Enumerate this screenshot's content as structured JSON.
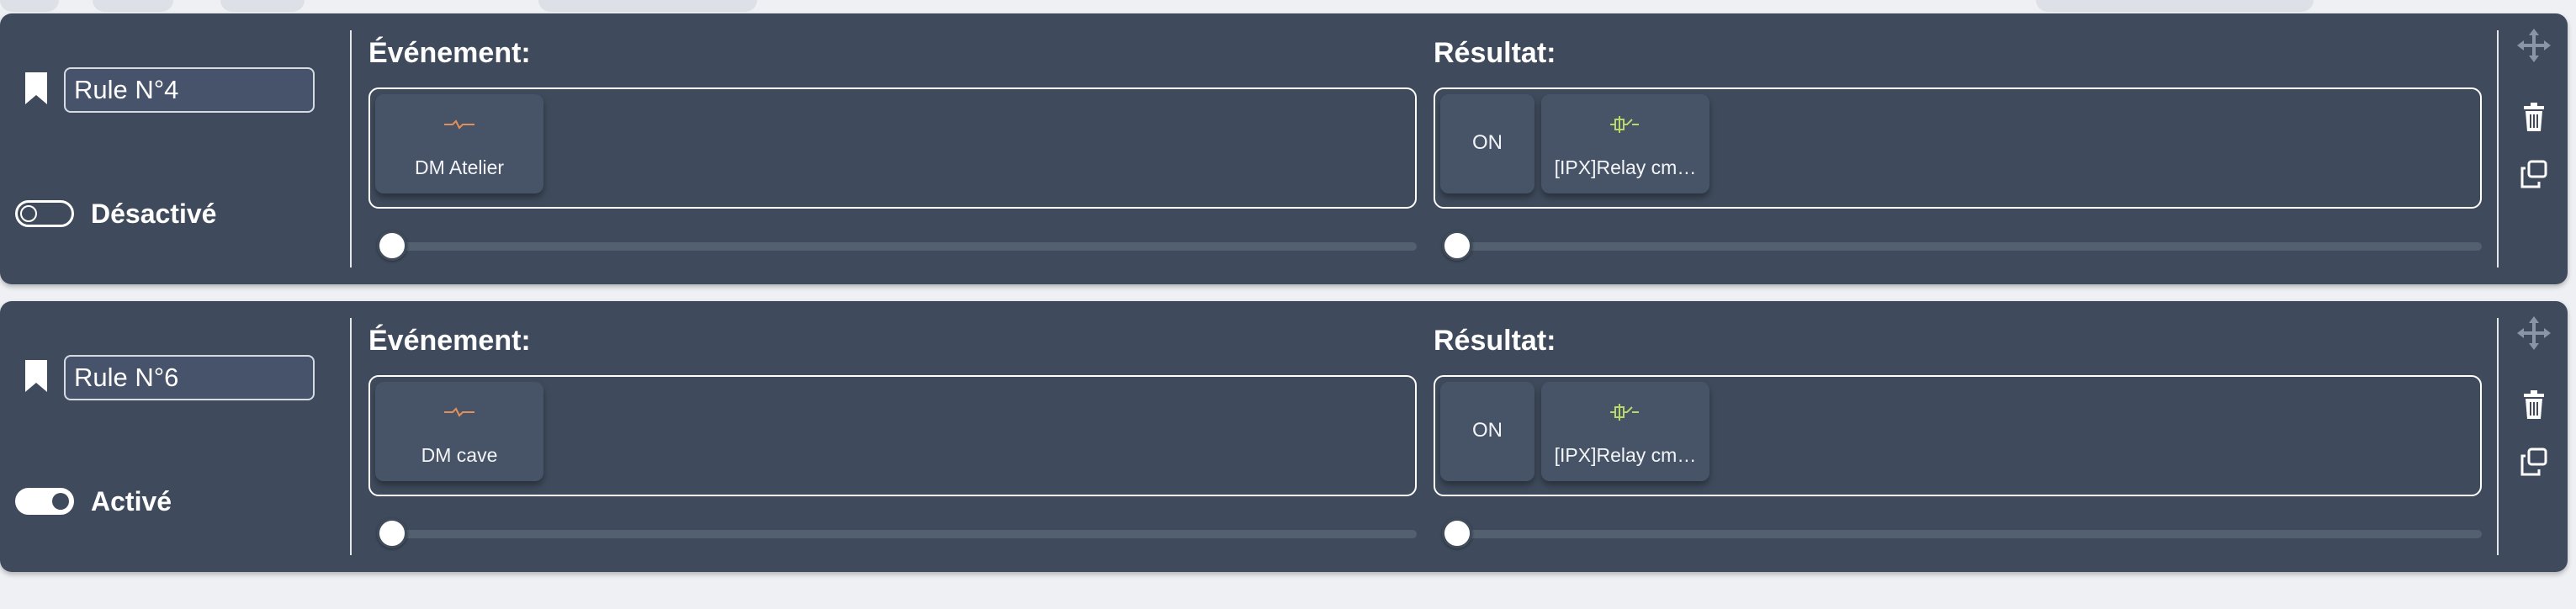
{
  "rules": [
    {
      "name": "Rule N°4",
      "enabled": false,
      "status_label": "Désactivé",
      "event": {
        "title": "Événement:",
        "tiles": [
          {
            "icon": "sensor-wave-icon",
            "label": "DM Atelier"
          }
        ],
        "slider_value": 0
      },
      "result": {
        "title": "Résultat:",
        "tiles": [
          {
            "icon": "none",
            "label": "ON"
          },
          {
            "icon": "relay-icon",
            "label": "[IPX]Relay cm…"
          }
        ],
        "slider_value": 0
      }
    },
    {
      "name": "Rule N°6",
      "enabled": true,
      "status_label": "Activé",
      "event": {
        "title": "Événement:",
        "tiles": [
          {
            "icon": "sensor-wave-icon",
            "label": "DM cave"
          }
        ],
        "slider_value": 0
      },
      "result": {
        "title": "Résultat:",
        "tiles": [
          {
            "icon": "none",
            "label": "ON"
          },
          {
            "icon": "relay-icon",
            "label": "[IPX]Relay cm…"
          }
        ],
        "slider_value": 0
      }
    }
  ],
  "colors": {
    "card_bg": "#3f4b5c",
    "tile_bg": "#475467",
    "page_bg": "#eef0f4",
    "sensor_icon": "#e0905a",
    "relay_icon": "#b8d96a"
  },
  "actions": [
    "move-icon",
    "trash-icon",
    "duplicate-icon"
  ]
}
